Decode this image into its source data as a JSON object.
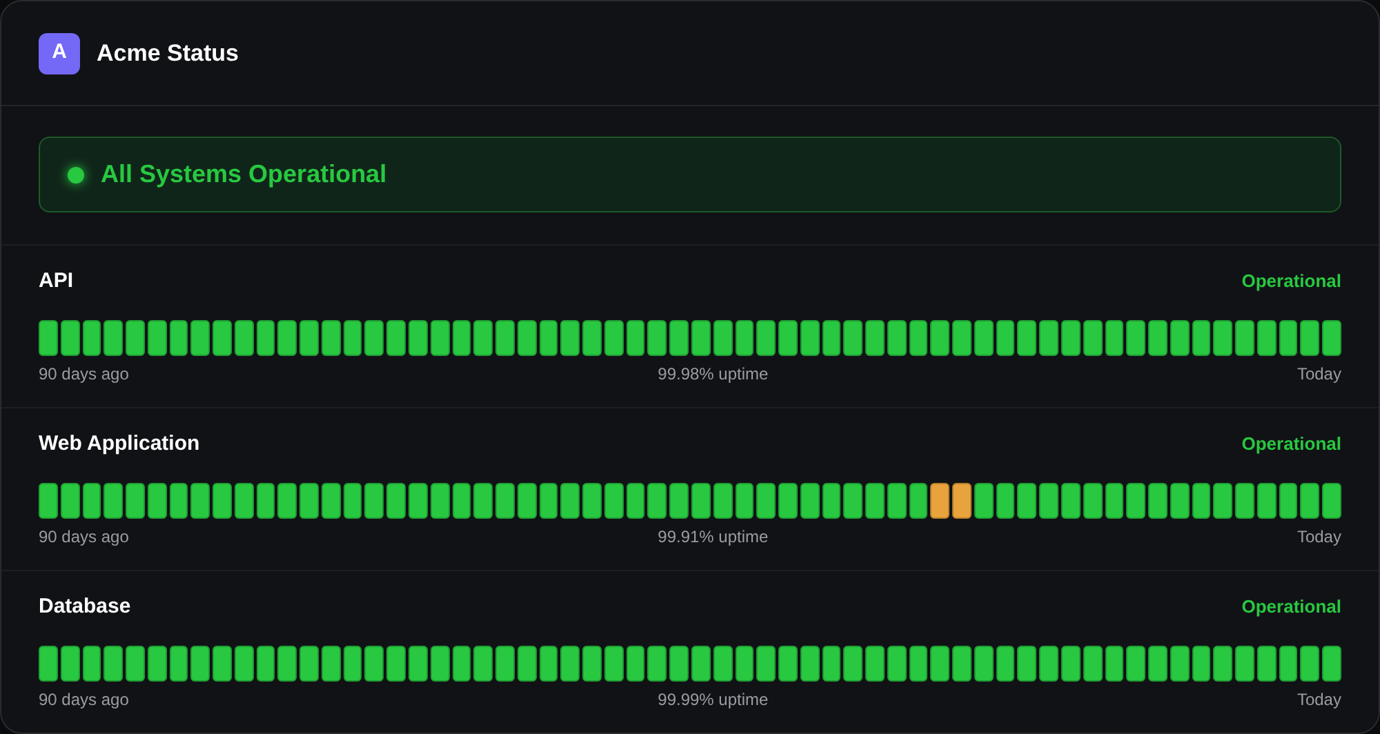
{
  "header": {
    "logo_letter": "A",
    "title": "Acme Status"
  },
  "banner": {
    "text": "All Systems Operational"
  },
  "services": [
    {
      "name": "API",
      "status": "Operational",
      "start_label": "90 days ago",
      "uptime": "99.98% uptime",
      "end_label": "Today",
      "days": [
        {
          "kind": "up"
        },
        {
          "kind": "up"
        },
        {
          "kind": "up"
        },
        {
          "kind": "up"
        },
        {
          "kind": "up"
        },
        {
          "kind": "up"
        },
        {
          "kind": "up"
        },
        {
          "kind": "up"
        },
        {
          "kind": "up"
        },
        {
          "kind": "up"
        },
        {
          "kind": "up"
        },
        {
          "kind": "up"
        },
        {
          "kind": "up"
        },
        {
          "kind": "up"
        },
        {
          "kind": "up"
        },
        {
          "kind": "up"
        },
        {
          "kind": "up"
        },
        {
          "kind": "up"
        },
        {
          "kind": "up"
        },
        {
          "kind": "up"
        },
        {
          "kind": "up"
        },
        {
          "kind": "up"
        },
        {
          "kind": "up"
        },
        {
          "kind": "up"
        },
        {
          "kind": "up"
        },
        {
          "kind": "up"
        },
        {
          "kind": "up"
        },
        {
          "kind": "up"
        },
        {
          "kind": "up"
        },
        {
          "kind": "up"
        },
        {
          "kind": "up"
        },
        {
          "kind": "up"
        },
        {
          "kind": "up"
        },
        {
          "kind": "up"
        },
        {
          "kind": "up"
        },
        {
          "kind": "up"
        },
        {
          "kind": "up"
        },
        {
          "kind": "up"
        },
        {
          "kind": "up"
        },
        {
          "kind": "up"
        },
        {
          "kind": "up"
        },
        {
          "kind": "up"
        },
        {
          "kind": "up"
        },
        {
          "kind": "up"
        },
        {
          "kind": "up"
        },
        {
          "kind": "up"
        },
        {
          "kind": "up"
        },
        {
          "kind": "up"
        },
        {
          "kind": "up"
        },
        {
          "kind": "up"
        },
        {
          "kind": "up"
        },
        {
          "kind": "up"
        },
        {
          "kind": "up"
        },
        {
          "kind": "up"
        },
        {
          "kind": "up"
        },
        {
          "kind": "up"
        },
        {
          "kind": "up"
        },
        {
          "kind": "up"
        },
        {
          "kind": "up"
        },
        {
          "kind": "up"
        }
      ]
    },
    {
      "name": "Web Application",
      "status": "Operational",
      "start_label": "90 days ago",
      "uptime": "99.91% uptime",
      "end_label": "Today",
      "days": [
        {
          "kind": "up"
        },
        {
          "kind": "up"
        },
        {
          "kind": "up"
        },
        {
          "kind": "up"
        },
        {
          "kind": "up"
        },
        {
          "kind": "up"
        },
        {
          "kind": "up"
        },
        {
          "kind": "up"
        },
        {
          "kind": "up"
        },
        {
          "kind": "up"
        },
        {
          "kind": "up"
        },
        {
          "kind": "up"
        },
        {
          "kind": "up"
        },
        {
          "kind": "up"
        },
        {
          "kind": "up"
        },
        {
          "kind": "up"
        },
        {
          "kind": "up"
        },
        {
          "kind": "up"
        },
        {
          "kind": "up"
        },
        {
          "kind": "up"
        },
        {
          "kind": "up"
        },
        {
          "kind": "up"
        },
        {
          "kind": "up"
        },
        {
          "kind": "up"
        },
        {
          "kind": "up"
        },
        {
          "kind": "up"
        },
        {
          "kind": "up"
        },
        {
          "kind": "up"
        },
        {
          "kind": "up"
        },
        {
          "kind": "up"
        },
        {
          "kind": "up"
        },
        {
          "kind": "up"
        },
        {
          "kind": "up"
        },
        {
          "kind": "up"
        },
        {
          "kind": "up"
        },
        {
          "kind": "up"
        },
        {
          "kind": "up"
        },
        {
          "kind": "up"
        },
        {
          "kind": "up"
        },
        {
          "kind": "up"
        },
        {
          "kind": "up"
        },
        {
          "kind": "degraded"
        },
        {
          "kind": "degraded"
        },
        {
          "kind": "up"
        },
        {
          "kind": "up"
        },
        {
          "kind": "up"
        },
        {
          "kind": "up"
        },
        {
          "kind": "up"
        },
        {
          "kind": "up"
        },
        {
          "kind": "up"
        },
        {
          "kind": "up"
        },
        {
          "kind": "up"
        },
        {
          "kind": "up"
        },
        {
          "kind": "up"
        },
        {
          "kind": "up"
        },
        {
          "kind": "up"
        },
        {
          "kind": "up"
        },
        {
          "kind": "up"
        },
        {
          "kind": "up"
        },
        {
          "kind": "up"
        }
      ]
    },
    {
      "name": "Database",
      "status": "Operational",
      "start_label": "90 days ago",
      "uptime": "99.99% uptime",
      "end_label": "Today",
      "days": [
        {
          "kind": "up"
        },
        {
          "kind": "up"
        },
        {
          "kind": "up"
        },
        {
          "kind": "up"
        },
        {
          "kind": "up"
        },
        {
          "kind": "up"
        },
        {
          "kind": "up"
        },
        {
          "kind": "up"
        },
        {
          "kind": "up"
        },
        {
          "kind": "up"
        },
        {
          "kind": "up"
        },
        {
          "kind": "up"
        },
        {
          "kind": "up"
        },
        {
          "kind": "up"
        },
        {
          "kind": "up"
        },
        {
          "kind": "up"
        },
        {
          "kind": "up"
        },
        {
          "kind": "up"
        },
        {
          "kind": "up"
        },
        {
          "kind": "up"
        },
        {
          "kind": "up"
        },
        {
          "kind": "up"
        },
        {
          "kind": "up"
        },
        {
          "kind": "up"
        },
        {
          "kind": "up"
        },
        {
          "kind": "up"
        },
        {
          "kind": "up"
        },
        {
          "kind": "up"
        },
        {
          "kind": "up"
        },
        {
          "kind": "up"
        },
        {
          "kind": "up"
        },
        {
          "kind": "up"
        },
        {
          "kind": "up"
        },
        {
          "kind": "up"
        },
        {
          "kind": "up"
        },
        {
          "kind": "up"
        },
        {
          "kind": "up"
        },
        {
          "kind": "up"
        },
        {
          "kind": "up"
        },
        {
          "kind": "up"
        },
        {
          "kind": "up"
        },
        {
          "kind": "up"
        },
        {
          "kind": "up"
        },
        {
          "kind": "up"
        },
        {
          "kind": "up"
        },
        {
          "kind": "up"
        },
        {
          "kind": "up"
        },
        {
          "kind": "up"
        },
        {
          "kind": "up"
        },
        {
          "kind": "up"
        },
        {
          "kind": "up"
        },
        {
          "kind": "up"
        },
        {
          "kind": "up"
        },
        {
          "kind": "up"
        },
        {
          "kind": "up"
        },
        {
          "kind": "up"
        },
        {
          "kind": "up"
        },
        {
          "kind": "up"
        },
        {
          "kind": "up"
        },
        {
          "kind": "up"
        }
      ]
    }
  ]
}
